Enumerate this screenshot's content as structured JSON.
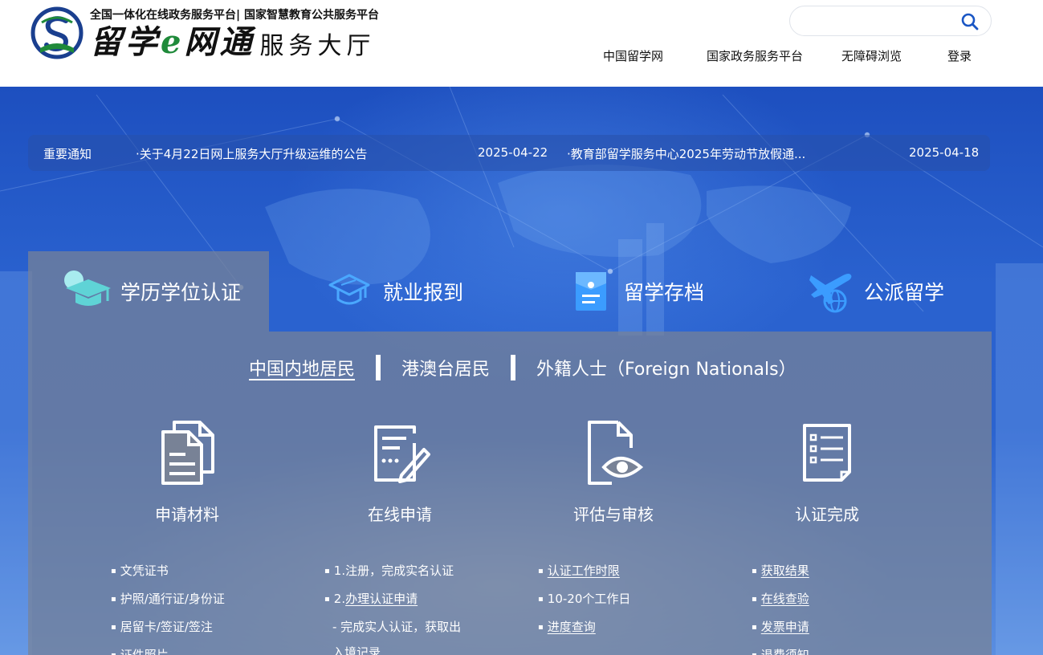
{
  "header": {
    "subtitle": "全国一体化在线政务服务平台| 国家智慧教育公共服务平台",
    "brand_part1": "留学",
    "brand_e": "e",
    "brand_part2": "网通",
    "brand_suffix": "服务大厅",
    "search": {
      "value": "",
      "placeholder": ""
    },
    "nav": [
      "中国留学网",
      "国家政务服务平台",
      "无障碍浏览",
      "登录"
    ]
  },
  "notices": {
    "label": "重要通知",
    "items": [
      {
        "title": "·关于4月22日网上服务大厅升级运维的公告",
        "date": "2025-04-22"
      },
      {
        "title": "·教育部留学服务中心2025年劳动节放假通...",
        "date": "2025-04-18"
      }
    ]
  },
  "service_tabs": [
    {
      "label": "学历学位认证",
      "icon": "graduation-cap-icon",
      "active": true
    },
    {
      "label": "就业报到",
      "icon": "mortarboard-outline-icon",
      "active": false
    },
    {
      "label": "留学存档",
      "icon": "archive-folder-icon",
      "active": false
    },
    {
      "label": "公派留学",
      "icon": "airplane-globe-icon",
      "active": false
    }
  ],
  "resident_tabs": [
    "中国内地居民",
    "港澳台居民",
    "外籍人士（Foreign Nationals）"
  ],
  "steps": [
    {
      "label": "申请材料",
      "icon": "documents-icon",
      "items": [
        {
          "text": "文凭证书",
          "bullet": true,
          "link": false
        },
        {
          "text": "护照/通行证/身份证",
          "bullet": true,
          "link": false
        },
        {
          "text": "居留卡/签证/签注",
          "bullet": true,
          "link": false
        },
        {
          "text": "证件照片",
          "bullet": true,
          "link": false
        }
      ]
    },
    {
      "label": "在线申请",
      "icon": "form-edit-icon",
      "items": [
        {
          "prefix": "1.",
          "text": "注册，完成实名认证",
          "bullet": true,
          "link": false
        },
        {
          "prefix": "2.",
          "text": "办理认证申请",
          "bullet": true,
          "link": true
        },
        {
          "text": " - 完成实人认证，获取出",
          "bullet": false,
          "link": false
        },
        {
          "text": "入境记录",
          "bullet": false,
          "link": false
        }
      ]
    },
    {
      "label": "评估与审核",
      "icon": "document-eye-icon",
      "items": [
        {
          "text": "认证工作时限",
          "bullet": true,
          "link": true
        },
        {
          "text": "10-20个工作日",
          "bullet": true,
          "link": false
        },
        {
          "text": "进度查询",
          "bullet": true,
          "link": true
        }
      ]
    },
    {
      "label": "认证完成",
      "icon": "checklist-icon",
      "items": [
        {
          "text": "获取结果",
          "bullet": true,
          "link": true
        },
        {
          "text": "在线查验",
          "bullet": true,
          "link": true
        },
        {
          "text": "发票申请",
          "bullet": true,
          "link": true
        },
        {
          "text": "退费须知",
          "bullet": true,
          "link": true
        }
      ]
    }
  ],
  "colors": {
    "banner_blue": "#2a62cf",
    "panel_gray": "#78829699",
    "logo_blue": "#1a3f8f",
    "logo_green": "#1f8a3a",
    "icon_cyan": "#5fd3d6",
    "search_icon": "#1a56c4"
  }
}
